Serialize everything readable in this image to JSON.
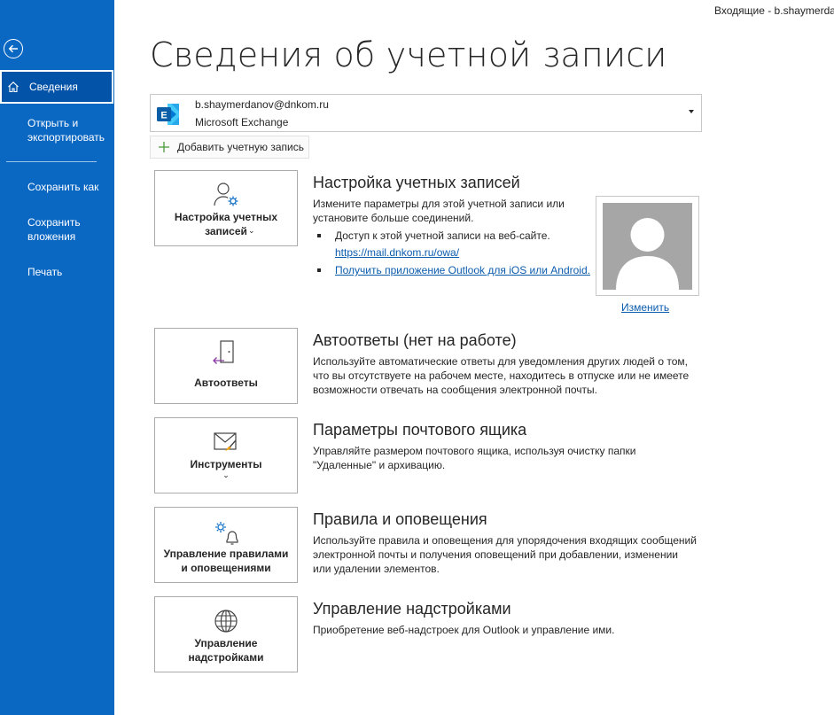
{
  "window": {
    "title": "Входящие - b.shaymerdanov@dnkom.ru - Outlook"
  },
  "sidebar": {
    "items": [
      {
        "label": "Сведения"
      },
      {
        "label": "Открыть и\nэкспортировать"
      },
      {
        "label": "Сохранить как"
      },
      {
        "label": "Сохранить\nвложения"
      },
      {
        "label": "Печать"
      }
    ]
  },
  "page": {
    "title": "Сведения об учетной записи"
  },
  "account": {
    "email": "b.shaymerdanov@dnkom.ru",
    "type": "Microsoft Exchange",
    "add_label": "Добавить учетную запись"
  },
  "sections": {
    "account_settings": {
      "tile_label": "Настройка учетных\nзаписей",
      "title": "Настройка учетных записей",
      "text": "Измените параметры для этой учетной записи или\nустановите больше соединений.",
      "bullet1": "Доступ к этой учетной записи на веб-сайте.",
      "bullet1_link": "https://mail.dnkom.ru/owa/",
      "bullet2_link": "Получить приложение Outlook для iOS или Android.",
      "change_photo": "Изменить"
    },
    "auto_replies": {
      "tile_label": "Автоответы",
      "title": "Автоответы (нет на работе)",
      "text": "Используйте автоматические ответы для уведомления других людей о том,\nчто вы отсутствуете на рабочем месте, находитесь в отпуске или не имеете\nвозможности отвечать на сообщения электронной почты."
    },
    "mailbox": {
      "tile_label": "Инструменты",
      "title": "Параметры почтового ящика",
      "text": "Управляйте размером почтового ящика, используя очистку папки\n\"Удаленные\" и архивацию."
    },
    "rules": {
      "tile_label": "Управление правилами\nи оповещениями",
      "title": "Правила и оповещения",
      "text": "Используйте правила и оповещения для упорядочения входящих сообщений\nэлектронной почты и получения оповещений при добавлении, изменении\nили удалении элементов."
    },
    "addins": {
      "tile_label": "Управление\nнадстройками",
      "title": "Управление надстройками",
      "text": "Приобретение веб-надстроек для Outlook и управление ими."
    }
  }
}
